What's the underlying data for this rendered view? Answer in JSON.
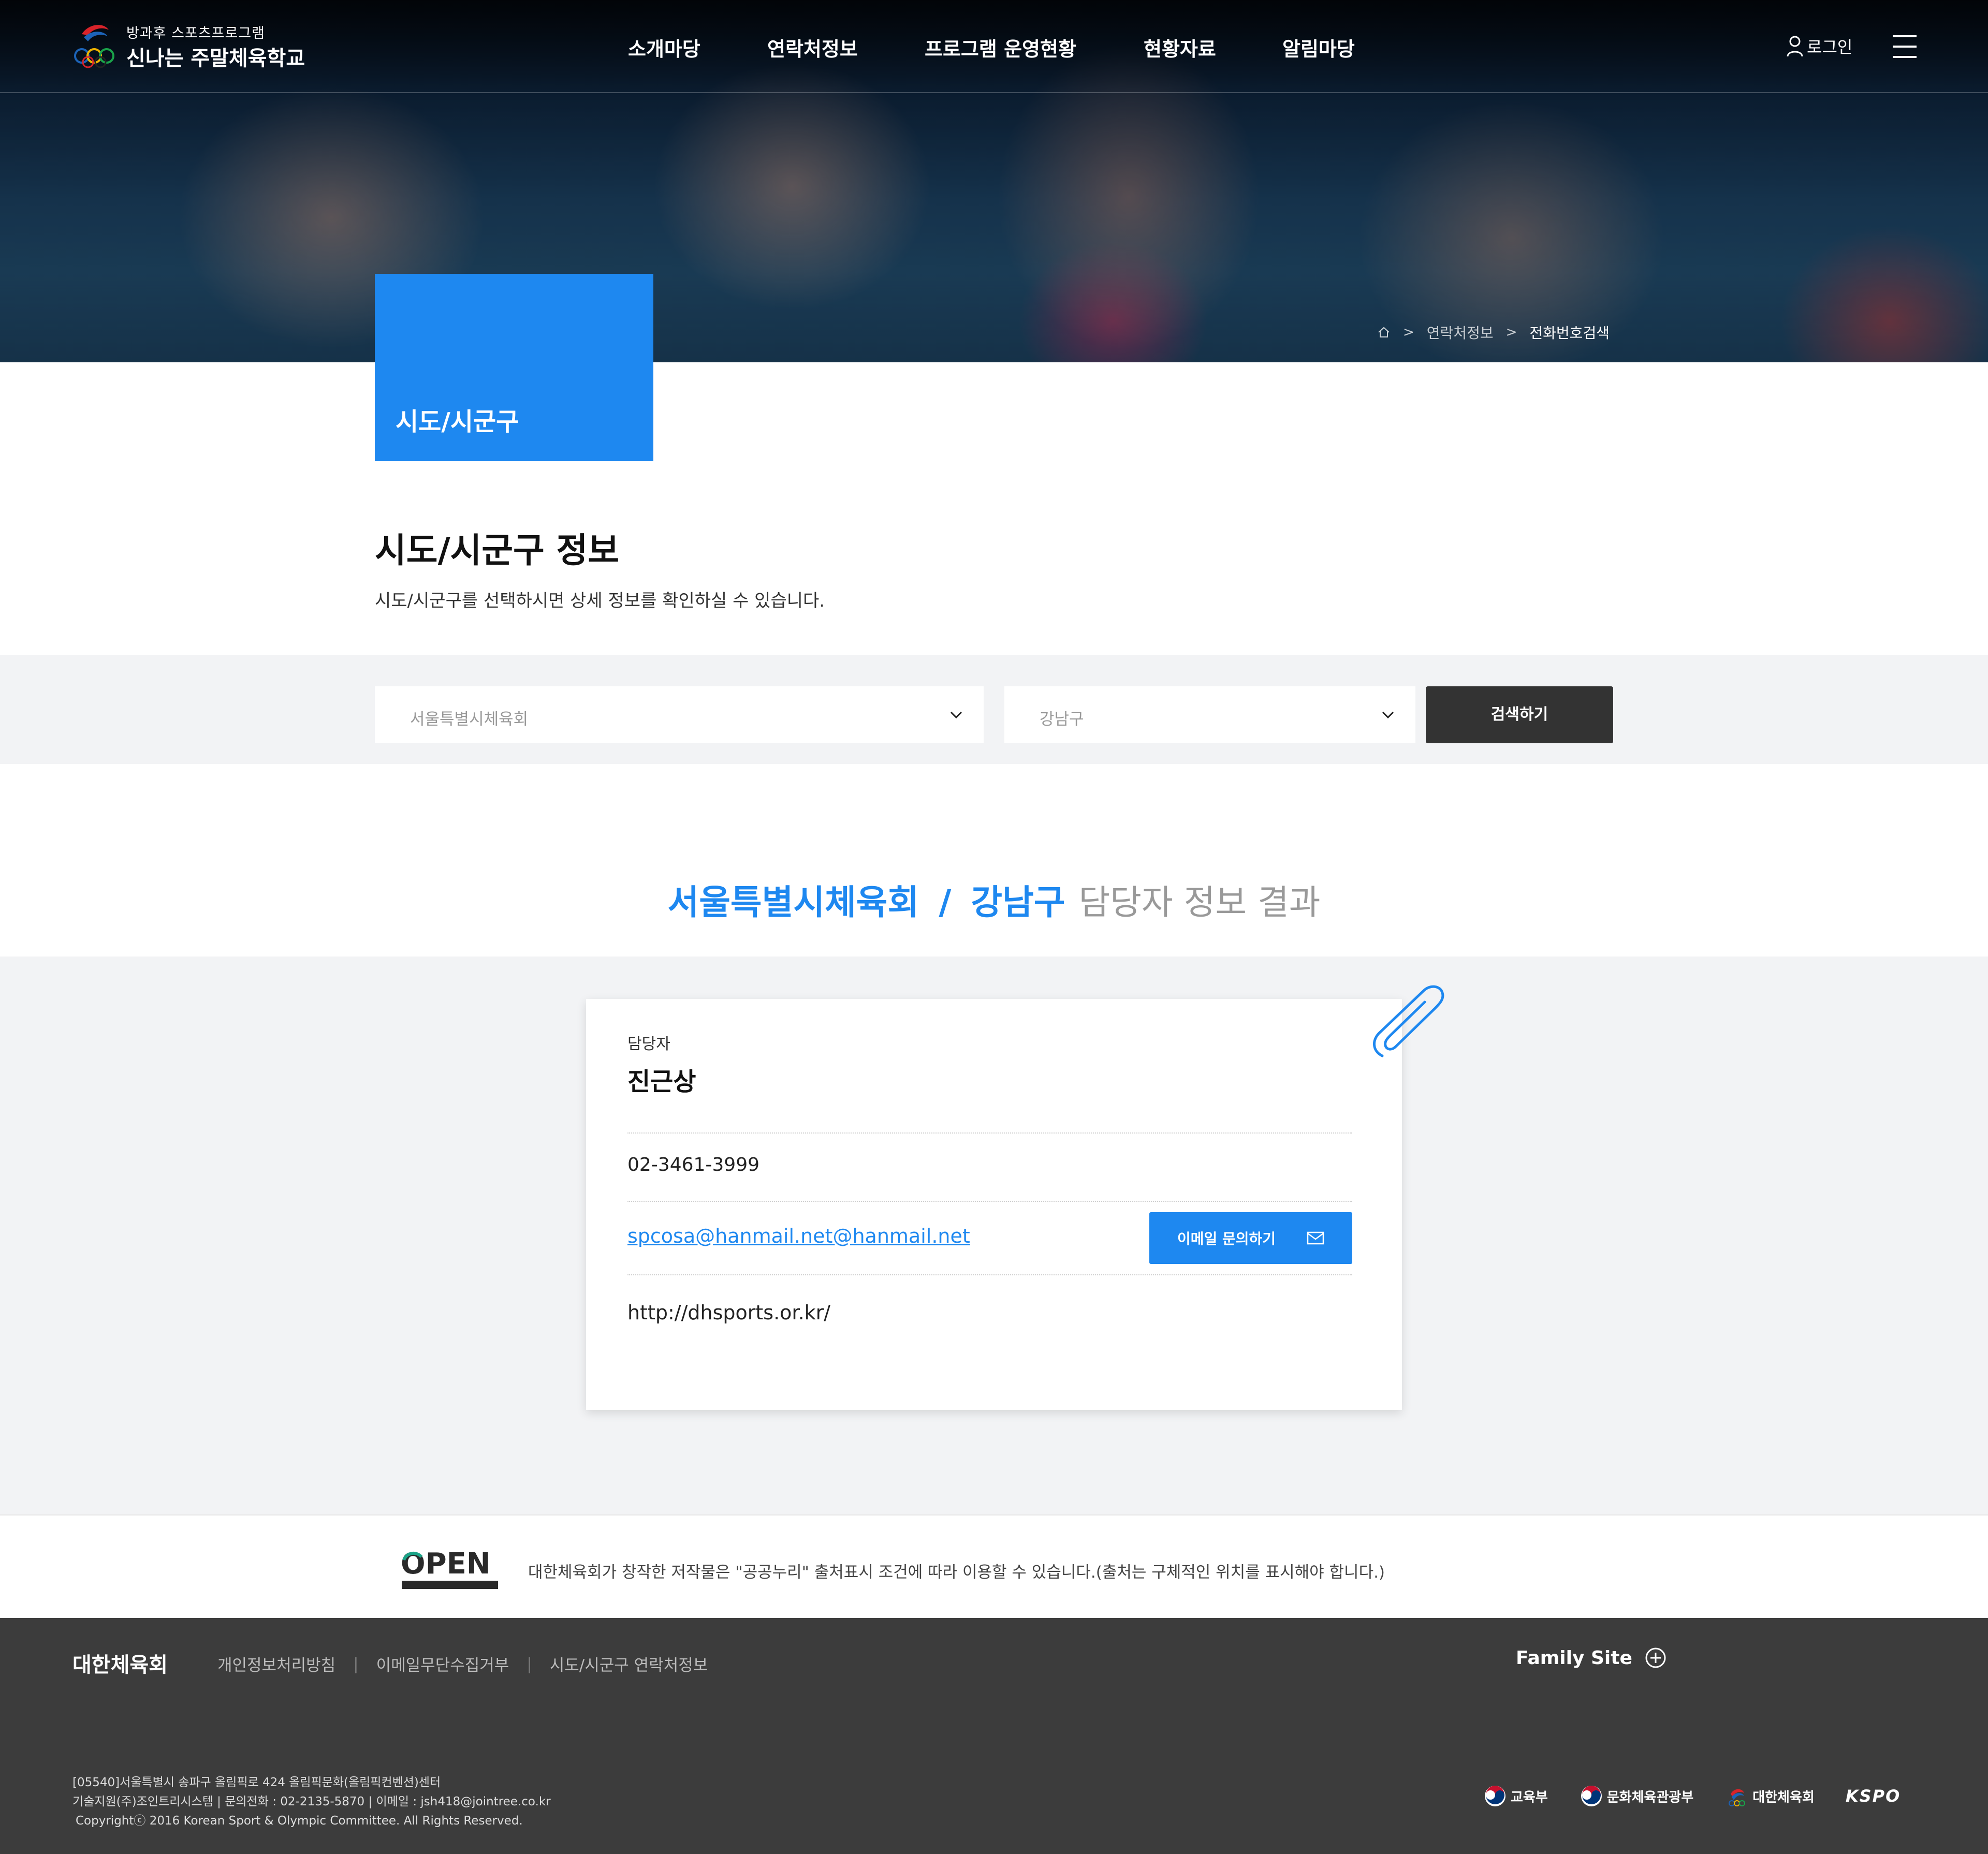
{
  "header": {
    "logo_sub": "방과후 스포츠프로그램",
    "logo_main": "신나는 주말체육학교",
    "nav": [
      {
        "label": "소개마당"
      },
      {
        "label": "연락처정보"
      },
      {
        "label": "프로그램 운영현황"
      },
      {
        "label": "현황자료"
      },
      {
        "label": "알림마당"
      }
    ],
    "login_label": "로그인",
    "icons": {
      "login": "user-icon",
      "menu": "hamburger-menu-icon",
      "home": "home-icon"
    }
  },
  "breadcrumb": {
    "items": [
      "연락처정보",
      "전화번호검색"
    ]
  },
  "page_tab": {
    "title": "시도/시군구"
  },
  "section": {
    "title": "시도/시군구 정보",
    "description": "시도/시군구를 선택하시면 상세 정보를 확인하실 수 있습니다."
  },
  "search": {
    "sido_value": "서울특별시체육회",
    "sigungu_value": "강남구",
    "button_label": "검색하기"
  },
  "result_title": {
    "sido": "서울특별시체육회",
    "slash": "/",
    "sigungu": "강남구",
    "suffix": "담당자 정보 결과"
  },
  "contact_card": {
    "label": "담당자",
    "name": "진근상",
    "phone": "02-3461-3999",
    "email": "spcosa@hanmail.net@hanmail.net",
    "email_button": "이메일 문의하기",
    "url": "http://dhsports.or.kr/"
  },
  "open_license": {
    "logo_text": "OPEN",
    "text": "대한체육회가 창작한 저작물은 \"공공누리\" 출처표시 조건에 따라 이용할 수 있습니다.(출처는 구체적인 위치를 표시해야 합니다.)"
  },
  "footer": {
    "org": "대한체육회",
    "links": [
      "개인정보처리방침",
      "이메일무단수집거부",
      "시도/시군구 연락처정보"
    ],
    "family_site": "Family Site",
    "address": "[05540]서울특별시 송파구 올림픽로 424 올림픽문화(올림픽컨벤션)센터",
    "support": "기술지원(주)조인트리시스템 | 문의전화 : 02-2135-5870 | 이메일 : jsh418@jointree.co.kr",
    "copyright": "Copyrightⓒ 2016 Korean Sport & Olympic Committee. All Rights Reserved.",
    "partners": [
      "교육부",
      "문화체육관광부",
      "대한체육회",
      "KSPO"
    ]
  },
  "colors": {
    "accent": "#1e88f0",
    "dark_button": "#333333",
    "footer_bg": "#3c3c3c",
    "band_bg": "#f2f3f5"
  }
}
